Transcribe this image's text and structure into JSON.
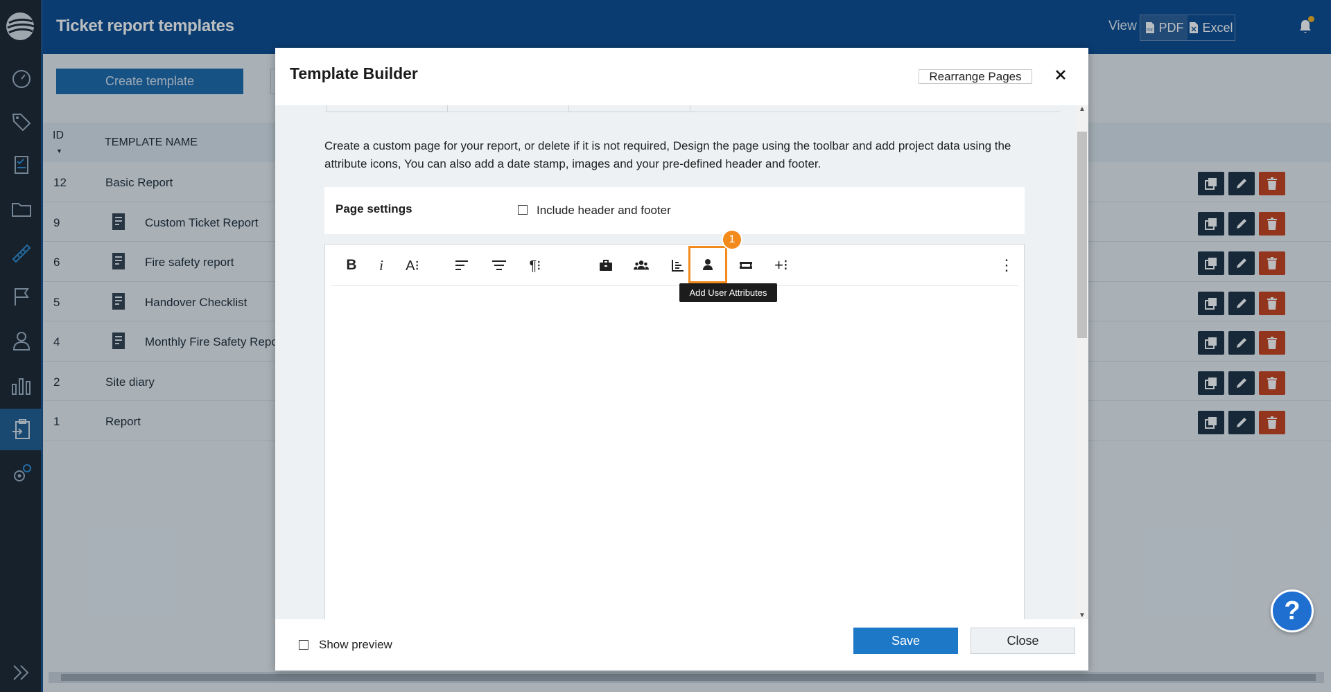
{
  "app": {
    "title": "Ticket report templates"
  },
  "header": {
    "view_label": "View",
    "view_options": [
      "PDF",
      "Excel"
    ]
  },
  "sidebar": {
    "items": [
      {
        "icon": "dashboard-icon"
      },
      {
        "icon": "tag-icon"
      },
      {
        "icon": "checklist-icon"
      },
      {
        "icon": "folder-icon"
      },
      {
        "icon": "ruler-icon"
      },
      {
        "icon": "flag-icon"
      },
      {
        "icon": "user-icon"
      },
      {
        "icon": "bar-chart-icon"
      },
      {
        "icon": "report-clipboard-icon",
        "active": true
      },
      {
        "icon": "settings-icon"
      }
    ]
  },
  "main": {
    "create_button": "Create template",
    "table": {
      "columns": [
        "ID",
        "TEMPLATE NAME"
      ],
      "rows": [
        {
          "id": "12",
          "name": "Basic Report",
          "child": false
        },
        {
          "id": "9",
          "name": "Custom Ticket Report",
          "child": true
        },
        {
          "id": "6",
          "name": "Fire safety report",
          "child": true
        },
        {
          "id": "5",
          "name": "Handover Checklist",
          "child": true
        },
        {
          "id": "4",
          "name": "Monthly Fire Safety Repo",
          "child": true
        },
        {
          "id": "2",
          "name": "Site diary",
          "child": false
        },
        {
          "id": "1",
          "name": "Report",
          "child": false
        }
      ]
    }
  },
  "modal": {
    "title": "Template Builder",
    "rearrange_button": "Rearrange Pages",
    "description": "Create a custom page for your report, or delete if it is not required, Design the page using the toolbar and add project data using the attribute icons, You can also add a date stamp, images and your pre-defined header and footer.",
    "page_settings": {
      "label": "Page settings",
      "checkbox_label": "Include header and footer"
    },
    "toolbar": {
      "bold": "B",
      "italic": "i",
      "font_size": "A⁝",
      "paragraph": "¶⁝",
      "insert": "+⁝",
      "more": "⋮",
      "highlight_badge": "1",
      "tooltip": "Add User Attributes"
    },
    "footer": {
      "show_preview_label": "Show preview",
      "save_label": "Save",
      "close_label": "Close"
    }
  },
  "help": {
    "label": "?"
  },
  "colors": {
    "header_blue": "#0b4c92",
    "sidebar_dark": "#1b2633",
    "save_blue": "#1e78c8",
    "delete_red": "#c8411d",
    "highlight_orange": "#f28a1c"
  }
}
